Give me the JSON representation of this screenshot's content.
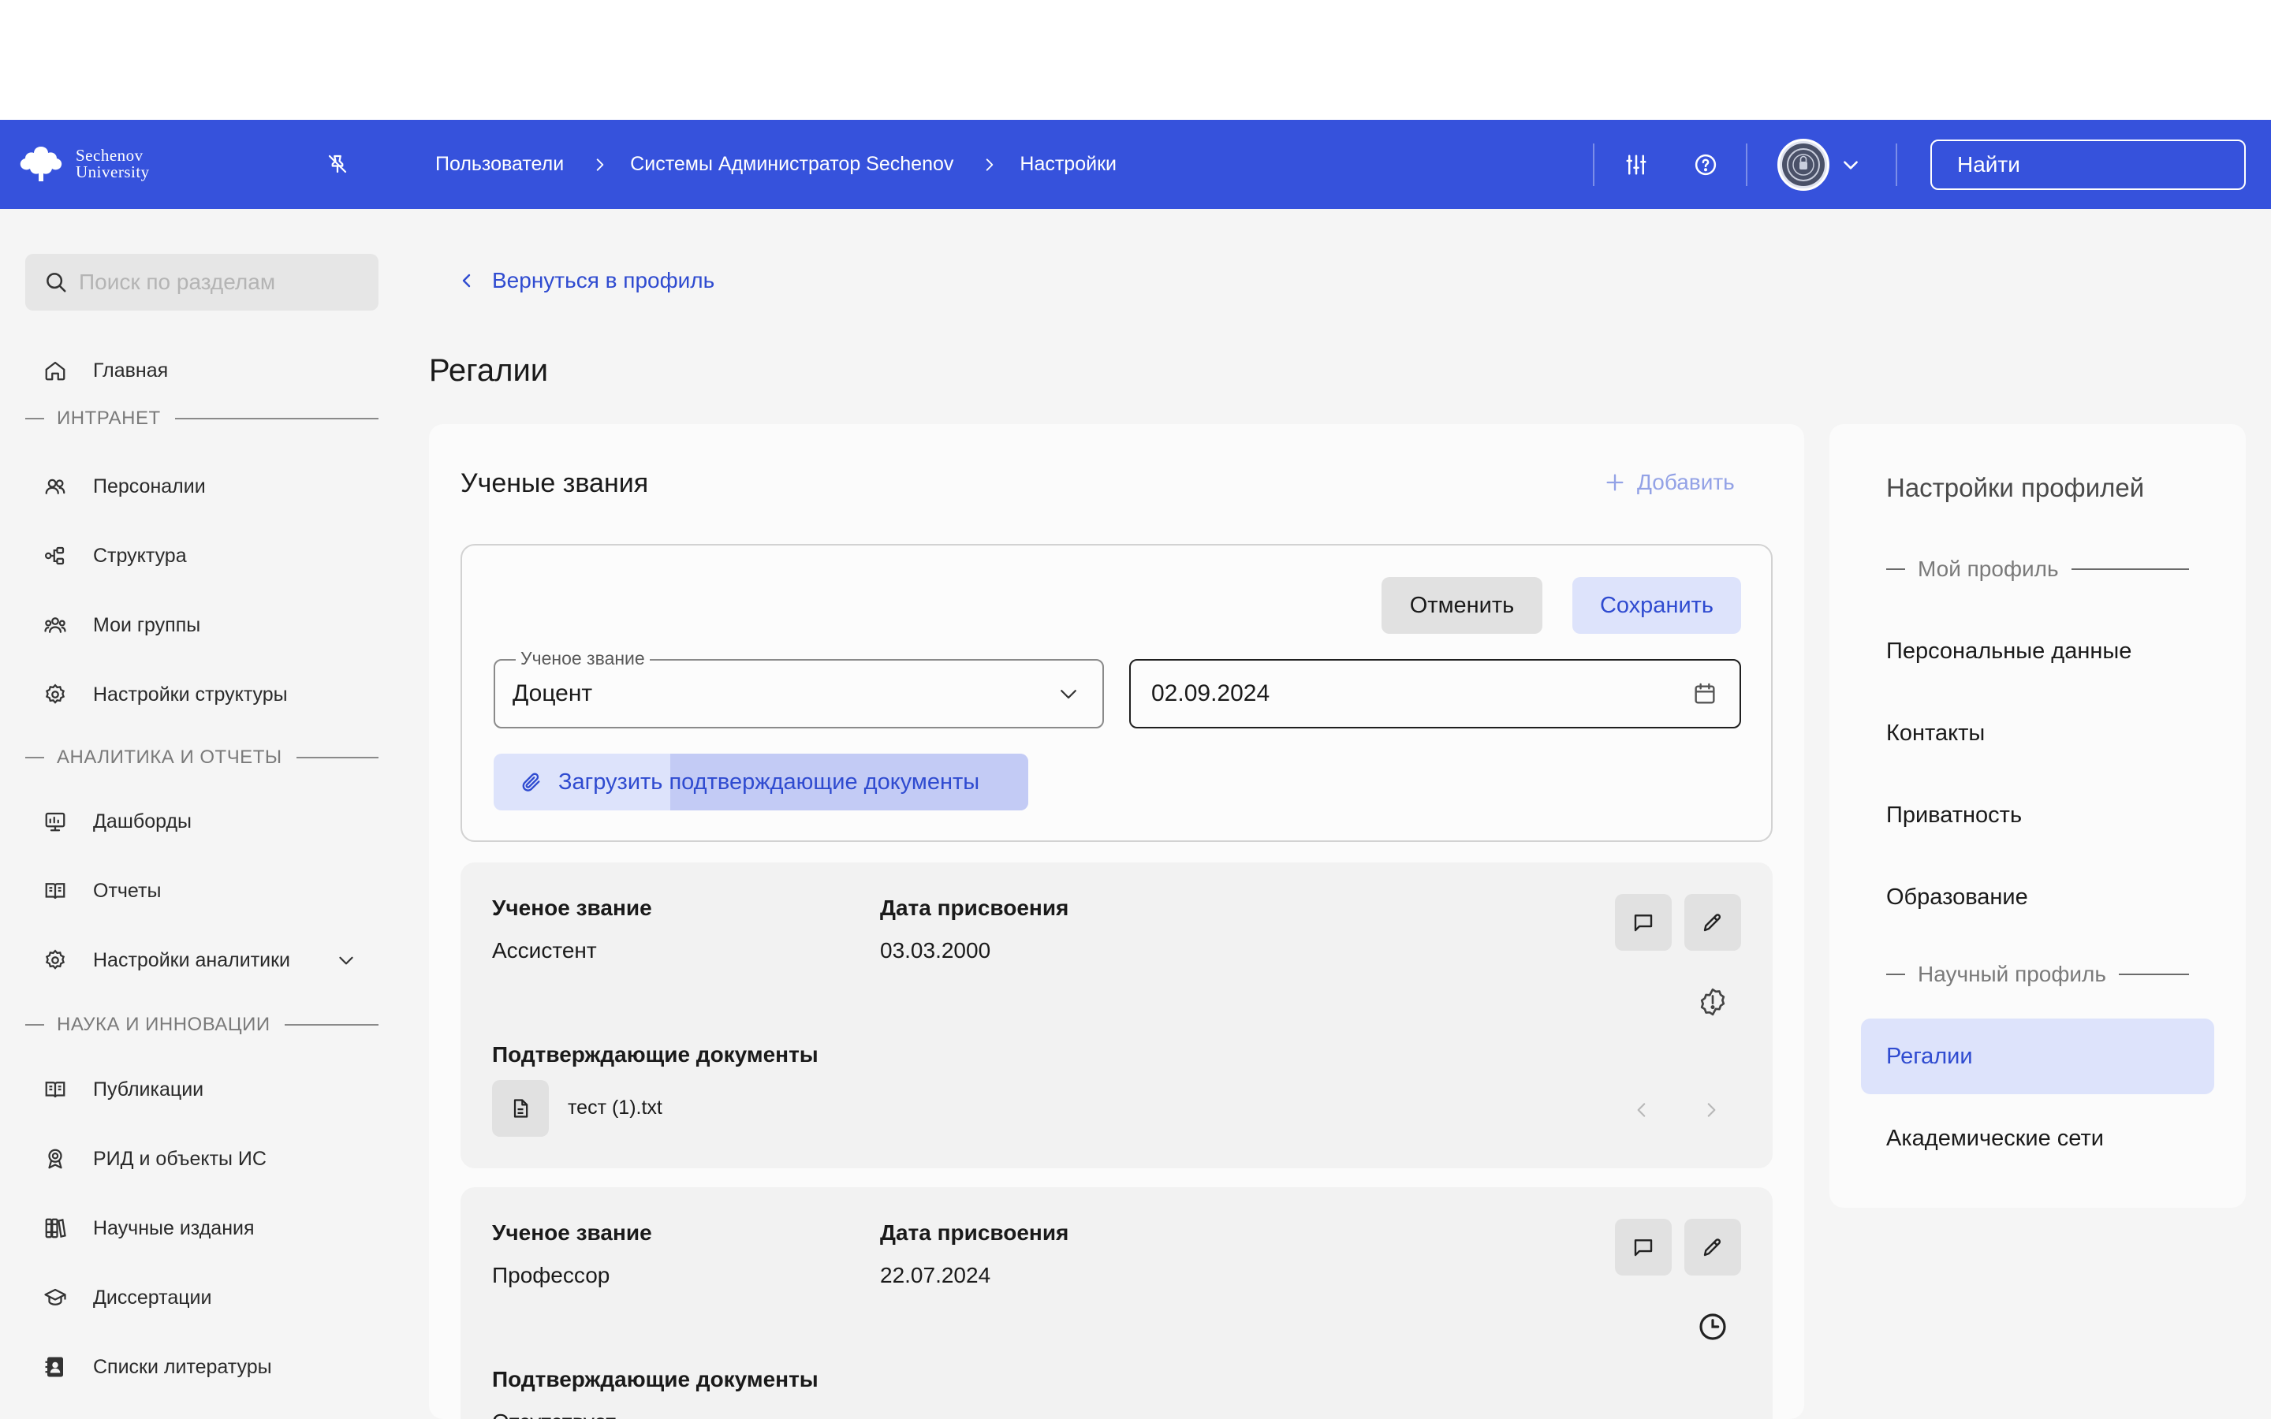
{
  "brand": {
    "logo_line1": "Sechenov",
    "logo_line2": "University",
    "header_bg": "#3652dc",
    "accent": "#2f4bd0",
    "accent_light": "#dde3fb"
  },
  "header": {
    "breadcrumbs": [
      {
        "label": "Пользователи"
      },
      {
        "label": "Системы Администратор Sechenov"
      },
      {
        "label": "Настройки"
      }
    ],
    "icons": [
      "pin-off-icon",
      "sliders-icon",
      "help-icon",
      "avatar",
      "chevron-down-icon",
      "search-icon"
    ],
    "search": {
      "placeholder": "Найти",
      "value": ""
    }
  },
  "sidebar": {
    "search": {
      "placeholder": "Поиск по разделам",
      "value": ""
    },
    "home": {
      "label": "Главная",
      "icon": "home-icon"
    },
    "sections": [
      {
        "title": "ИНТРАНЕТ",
        "items": [
          {
            "label": "Персоналии",
            "icon": "people-icon"
          },
          {
            "label": "Структура",
            "icon": "structure-icon"
          },
          {
            "label": "Мои группы",
            "icon": "group-icon"
          },
          {
            "label": "Настройки структуры",
            "icon": "gear-icon"
          }
        ]
      },
      {
        "title": "АНАЛИТИКА И ОТЧЕТЫ",
        "items": [
          {
            "label": "Дашборды",
            "icon": "dashboard-icon"
          },
          {
            "label": "Отчеты",
            "icon": "book-icon"
          },
          {
            "label": "Настройки аналитики",
            "icon": "gear-icon",
            "expandable": true
          }
        ]
      },
      {
        "title": "НАУКА И ИННОВАЦИИ",
        "items": [
          {
            "label": "Публикации",
            "icon": "book-icon"
          },
          {
            "label": "РИД и объекты ИС",
            "icon": "award-icon"
          },
          {
            "label": "Научные издания",
            "icon": "library-icon"
          },
          {
            "label": "Диссертации",
            "icon": "graduation-cap-icon"
          },
          {
            "label": "Списки литературы",
            "icon": "address-book-icon"
          }
        ]
      }
    ]
  },
  "main": {
    "back_link": "Вернуться в профиль",
    "page_title": "Регалии",
    "card": {
      "title": "Ученые звания",
      "add_label": "Добавить",
      "edit_form": {
        "cancel_label": "Отменить",
        "save_label": "Сохранить",
        "rank_label": "Ученое звание",
        "rank_value": "Доцент",
        "date_value": "02.09.2024",
        "upload_label": "Загрузить подтверждающие документы"
      },
      "entries": [
        {
          "rank_header": "Ученое звание",
          "rank": "Ассистент",
          "date_header": "Дата присвоения",
          "date": "03.03.2000",
          "docs_header": "Подтверждающие документы",
          "file_name": "тест (1).txt",
          "status_icon": "warning-badge-icon"
        },
        {
          "rank_header": "Ученое звание",
          "rank": "Профессор",
          "date_header": "Дата присвоения",
          "date": "22.07.2024",
          "docs_header": "Подтверждающие документы",
          "docs_value": "Отсутствует",
          "status_icon": "clock-icon"
        }
      ]
    }
  },
  "right_panel": {
    "title": "Настройки профилей",
    "sections": [
      {
        "title": "Мой профиль",
        "items": [
          "Персональные данные",
          "Контакты",
          "Приватность",
          "Образование"
        ]
      },
      {
        "title": "Научный профиль",
        "items": [
          "Регалии",
          "Академические сети"
        ]
      }
    ],
    "active_item": "Регалии"
  }
}
